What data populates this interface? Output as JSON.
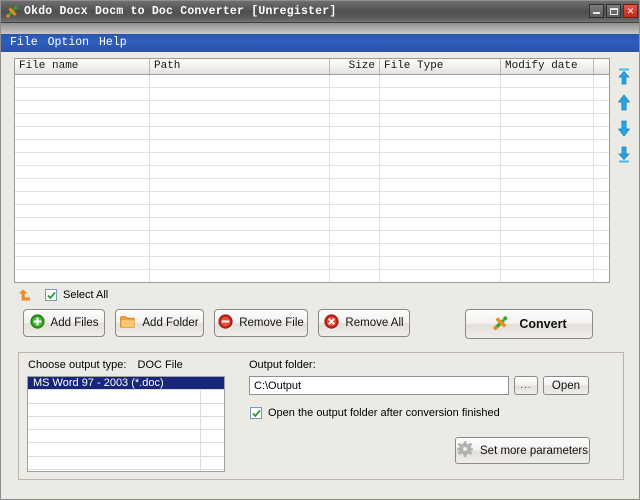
{
  "window": {
    "title": "Okdo Docx Docm to Doc Converter [Unregister]",
    "app_icon": "convert-arrows-icon",
    "controls": {
      "minimize": "minimize-button",
      "maximize": "maximize-button",
      "close_glyph": "✕"
    }
  },
  "menubar": {
    "items": [
      {
        "label": "File"
      },
      {
        "label": "Option"
      },
      {
        "label": "Help"
      }
    ]
  },
  "file_list": {
    "columns": [
      {
        "label": "File name",
        "align": "left"
      },
      {
        "label": "Path",
        "align": "left"
      },
      {
        "label": "Size",
        "align": "right"
      },
      {
        "label": "File Type",
        "align": "left"
      },
      {
        "label": "Modify date",
        "align": "left"
      },
      {
        "label": "",
        "align": "left"
      }
    ],
    "rows": [],
    "empty_row_count": 16
  },
  "order_buttons": [
    {
      "name": "move-to-top-button",
      "title": "Move to top"
    },
    {
      "name": "move-up-button",
      "title": "Move up"
    },
    {
      "name": "move-down-button",
      "title": "Move down"
    },
    {
      "name": "move-to-bottom-button",
      "title": "Move to bottom"
    }
  ],
  "select_all": {
    "label": "Select All",
    "checked": true
  },
  "actions": {
    "add_files": "Add Files",
    "add_folder": "Add Folder",
    "remove_file": "Remove File",
    "remove_all": "Remove All",
    "convert": "Convert"
  },
  "output_panel": {
    "output_type_label": "Choose output type:",
    "output_type_value": "DOC File",
    "format_list": [
      {
        "label": "MS Word 97 - 2003 (*.doc)",
        "selected": true
      }
    ],
    "format_list_empty_rows": 6,
    "output_folder_label": "Output folder:",
    "output_folder_value": "C:\\Output",
    "output_folder_placeholder": "",
    "browse_label": "...",
    "open_label": "Open",
    "open_after_label": "Open the output folder after conversion finished",
    "open_after_checked": true,
    "set_more_parameters": "Set more parameters"
  },
  "colors": {
    "menu_blue": "#2f5fbe",
    "selection_blue": "#17267a",
    "accent_orange": "#f08a24",
    "accent_green": "#3aa528",
    "remove_red": "#d93c2a",
    "arrow_cyan": "#29a3e0",
    "window_bg": "#eceae4"
  }
}
